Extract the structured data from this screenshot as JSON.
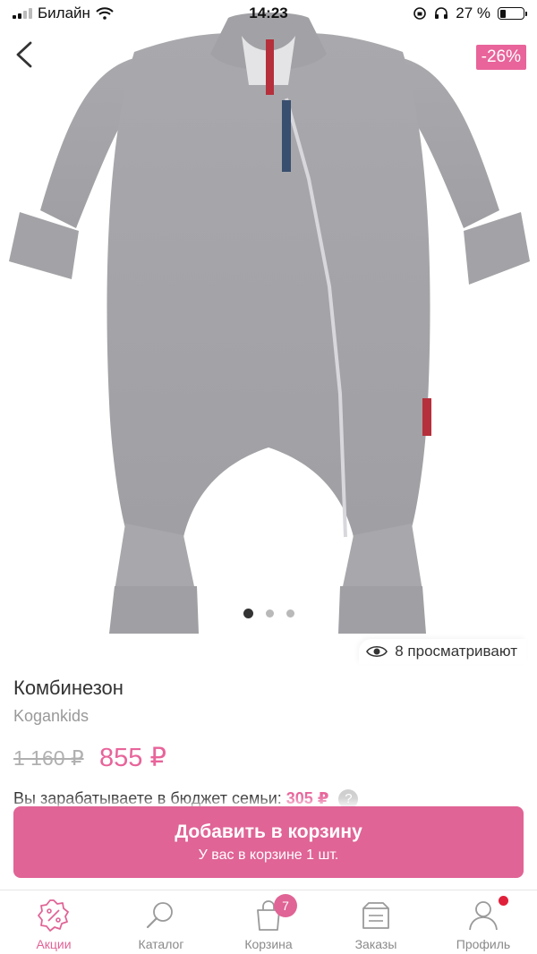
{
  "status_bar": {
    "carrier": "Билайн",
    "time": "14:23",
    "battery": "27 %",
    "battery_level": 0.27
  },
  "product": {
    "discount": "-26%",
    "title": "Комбинезон",
    "brand": "Kogankids",
    "old_price": "1 160 ₽",
    "new_price": "855 ₽",
    "viewers": "8 просматривают",
    "budget_text": "Вы зарабатываете в бюджет семьи:",
    "budget_amount": "305 ₽",
    "gallery": {
      "total": 3,
      "active": 1
    }
  },
  "cart_button": {
    "label": "Добавить в корзину",
    "sub": "У вас в корзине 1 шт."
  },
  "tabbar": {
    "items": [
      {
        "label": "Акции",
        "icon": "percent-icon",
        "active": true
      },
      {
        "label": "Каталог",
        "icon": "search-icon"
      },
      {
        "label": "Корзина",
        "icon": "bag-icon",
        "badge": "7"
      },
      {
        "label": "Заказы",
        "icon": "box-icon"
      },
      {
        "label": "Профиль",
        "icon": "profile-icon",
        "dot": true
      }
    ]
  },
  "colors": {
    "accent": "#e06496",
    "price": "#e8649a",
    "notification": "#e0203a"
  }
}
